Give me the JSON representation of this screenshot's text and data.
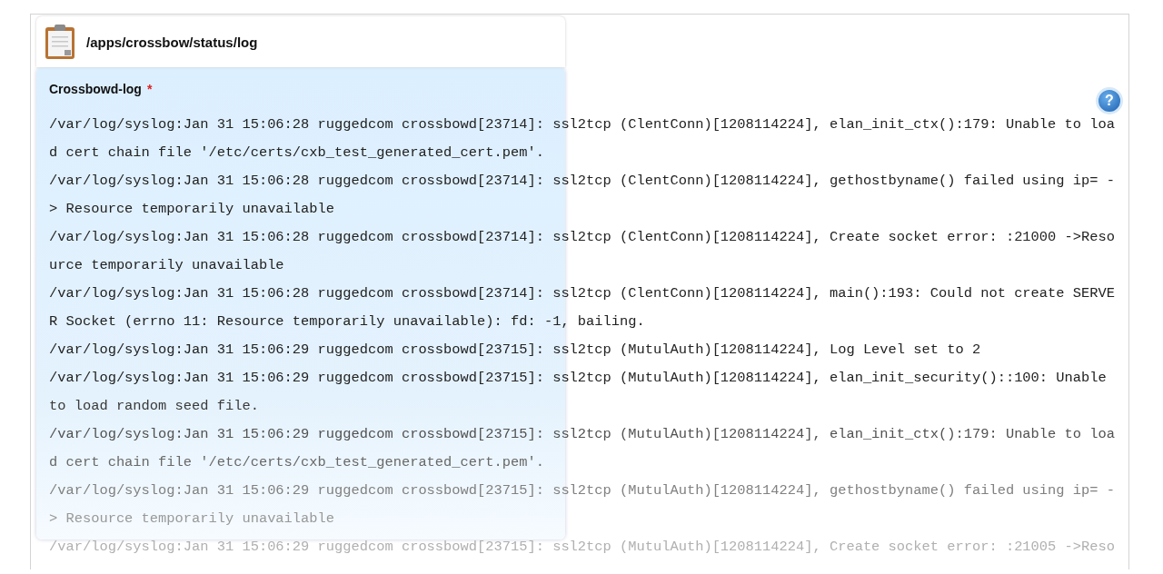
{
  "header": {
    "path": "/apps/crossbow/status/log"
  },
  "log": {
    "title": "Crossbowd-log",
    "required_mark": "*",
    "help": "?",
    "lines": [
      "/var/log/syslog:Jan 31 15:06:28 ruggedcom crossbowd[23714]: ssl2tcp (ClentConn)[1208114224], elan_init_ctx():179: Unable to loa",
      "d cert chain file '/etc/certs/cxb_test_generated_cert.pem'.",
      "/var/log/syslog:Jan 31 15:06:28 ruggedcom crossbowd[23714]: ssl2tcp (ClentConn)[1208114224], gethostbyname() failed using ip= -",
      "> Resource temporarily unavailable",
      "/var/log/syslog:Jan 31 15:06:28 ruggedcom crossbowd[23714]: ssl2tcp (ClentConn)[1208114224], Create socket error: :21000 ->Reso",
      "urce temporarily unavailable",
      "/var/log/syslog:Jan 31 15:06:28 ruggedcom crossbowd[23714]: ssl2tcp (ClentConn)[1208114224], main():193: Could not create SERVE",
      "R Socket (errno 11: Resource temporarily unavailable): fd: -1, bailing.",
      "/var/log/syslog:Jan 31 15:06:29 ruggedcom crossbowd[23715]: ssl2tcp (MutulAuth)[1208114224], Log Level set to 2",
      "/var/log/syslog:Jan 31 15:06:29 ruggedcom crossbowd[23715]: ssl2tcp (MutulAuth)[1208114224], elan_init_security()::100: Unable",
      "to load random seed file.",
      "/var/log/syslog:Jan 31 15:06:29 ruggedcom crossbowd[23715]: ssl2tcp (MutulAuth)[1208114224], elan_init_ctx():179: Unable to loa",
      "d cert chain file '/etc/certs/cxb_test_generated_cert.pem'.",
      "/var/log/syslog:Jan 31 15:06:29 ruggedcom crossbowd[23715]: ssl2tcp (MutulAuth)[1208114224], gethostbyname() failed using ip= -",
      "> Resource temporarily unavailable",
      "/var/log/syslog:Jan 31 15:06:29 ruggedcom crossbowd[23715]: ssl2tcp (MutulAuth)[1208114224], Create socket error: :21005 ->Reso"
    ]
  }
}
